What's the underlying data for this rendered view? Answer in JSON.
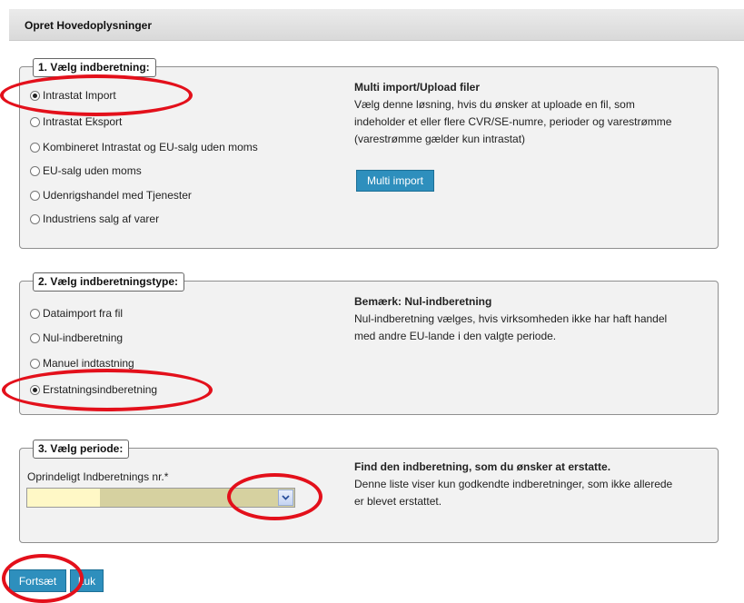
{
  "header": {
    "title": "Opret Hovedoplysninger"
  },
  "section1": {
    "legend": "1. Vælg indberetning:",
    "options": [
      {
        "label": "Intrastat Import",
        "checked": true
      },
      {
        "label": "Intrastat Eksport",
        "checked": false
      },
      {
        "label": "Kombineret Intrastat og EU-salg uden moms",
        "checked": false
      },
      {
        "label": "EU-salg uden moms",
        "checked": false
      },
      {
        "label": "Udenrigshandel med Tjenester",
        "checked": false
      },
      {
        "label": "Industriens salg af varer",
        "checked": false
      }
    ],
    "info_title": "Multi import/Upload filer",
    "info_lines": [
      "Vælg denne løsning, hvis du ønsker at uploade en fil, som",
      "indeholder et eller flere CVR/SE-numre, perioder og varestrømme",
      "(varestrømme gælder kun intrastat)"
    ],
    "multi_import_label": "Multi import"
  },
  "section2": {
    "legend": "2. Vælg indberetningstype:",
    "options": [
      {
        "label": "Dataimport fra fil",
        "checked": false
      },
      {
        "label": "Nul-indberetning",
        "checked": false
      },
      {
        "label": "Manuel indtastning",
        "checked": false
      },
      {
        "label": "Erstatningsindberetning",
        "checked": true
      }
    ],
    "info_title": "Bemærk: Nul-indberetning",
    "info_lines": [
      "Nul-indberetning vælges, hvis virksomheden ikke har haft handel",
      "med andre EU-lande i den valgte periode."
    ]
  },
  "section3": {
    "legend": "3. Vælg periode:",
    "field_label": "Oprindeligt Indberetnings nr.*",
    "select_value": "",
    "info_title": "Find den indberetning, som du ønsker at erstatte.",
    "info_lines": [
      "Denne liste viser kun godkendte indberetninger, som ikke allerede",
      "er blevet erstattet."
    ]
  },
  "footer": {
    "continue_label": "Fortsæt",
    "close_label": "Luk"
  },
  "colors": {
    "button": "#2e8fbd",
    "highlight_ring": "#e3101b",
    "select_fill": "#d6d1a0",
    "select_left": "#fff8c6"
  }
}
